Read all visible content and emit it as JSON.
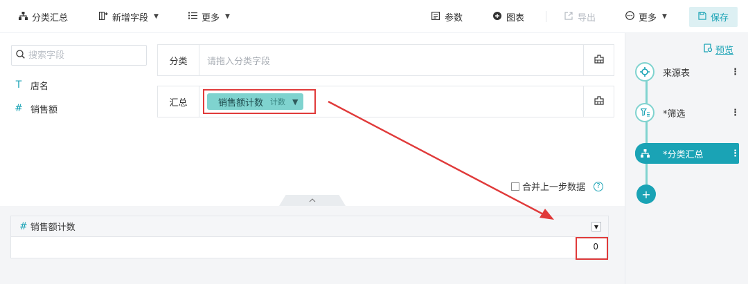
{
  "toolbar": {
    "group_summary": "分类汇总",
    "add_field": "新增字段",
    "more_left": "更多",
    "params": "参数",
    "chart": "图表",
    "export": "导出",
    "more_right": "更多",
    "save": "保存"
  },
  "left_panel": {
    "search_placeholder": "搜索字段",
    "fields": [
      {
        "type_glyph": "T",
        "name": "店名"
      },
      {
        "type_glyph": "#",
        "name": "销售额"
      }
    ]
  },
  "config": {
    "category_label": "分类",
    "category_placeholder": "请拖入分类字段",
    "summary_label": "汇总",
    "summary_field": "销售额计数",
    "summary_agg": "计数",
    "merge_label": "合并上一步数据",
    "help_glyph": "?"
  },
  "result": {
    "column_header": "销售额计数",
    "hash_glyph": "#",
    "rows": [
      "0"
    ]
  },
  "pipeline": {
    "preview": "预览",
    "steps": [
      {
        "label": "来源表"
      },
      {
        "label": "*筛选"
      },
      {
        "label": "*分类汇总"
      }
    ],
    "add_glyph": "+"
  },
  "colors": {
    "accent": "#1aa3b5",
    "pill": "#7fd3cf",
    "annotation": "#e03a3a"
  }
}
